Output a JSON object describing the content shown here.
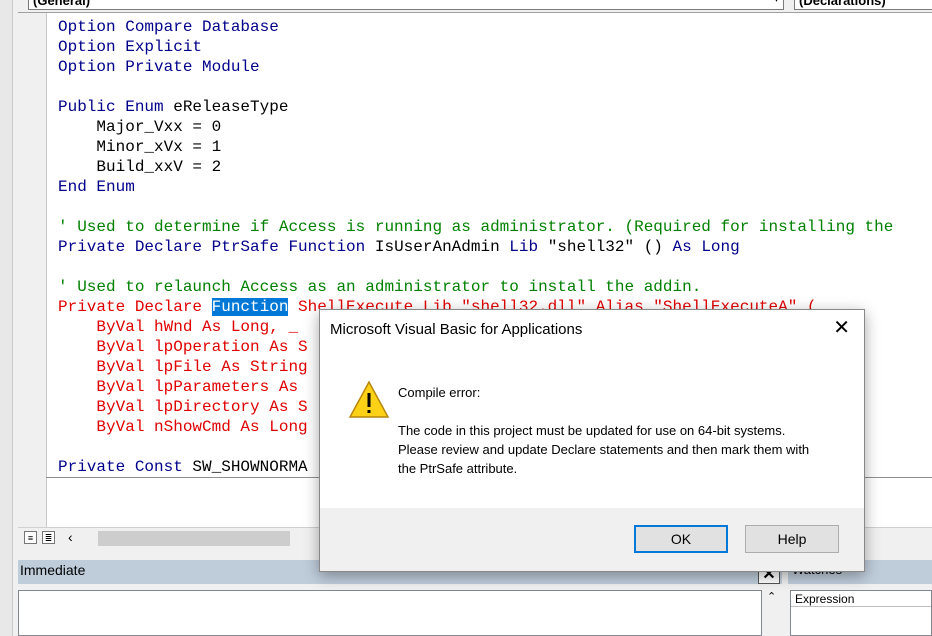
{
  "object_combo": "(General)",
  "proc_combo": "(Declarations)",
  "code_lines": [
    [
      {
        "t": "Option Compare Database",
        "c": "kw"
      }
    ],
    [
      {
        "t": "Option Explicit",
        "c": "kw"
      }
    ],
    [
      {
        "t": "Option Private Module",
        "c": "kw"
      }
    ],
    [],
    [
      {
        "t": "Public Enum ",
        "c": "kw"
      },
      {
        "t": "eReleaseType",
        "c": ""
      }
    ],
    [
      {
        "t": "    Major_Vxx = 0",
        "c": ""
      }
    ],
    [
      {
        "t": "    Minor_xVx = 1",
        "c": ""
      }
    ],
    [
      {
        "t": "    Build_xxV = 2",
        "c": ""
      }
    ],
    [
      {
        "t": "End Enum",
        "c": "kw"
      }
    ],
    [],
    [
      {
        "t": "' Used to determine if Access is running as administrator. (Required for installing the",
        "c": "cm"
      }
    ],
    [
      {
        "t": "Private Declare PtrSafe Function ",
        "c": "kw"
      },
      {
        "t": "IsUserAnAdmin ",
        "c": ""
      },
      {
        "t": "Lib ",
        "c": "kw"
      },
      {
        "t": "\"shell32\" () ",
        "c": ""
      },
      {
        "t": "As Long",
        "c": "kw"
      }
    ],
    [],
    [
      {
        "t": "' Used to relaunch Access as an administrator to install the addin.",
        "c": "cm"
      }
    ],
    [
      {
        "t": "Private Declare ",
        "c": "er"
      },
      {
        "t": "Function",
        "c": "sel"
      },
      {
        "t": " ShellExecute Lib \"shell32.dll\" Alias \"ShellExecuteA\" (_",
        "c": "er"
      }
    ],
    [
      {
        "t": "    ByVal hWnd As Long, _",
        "c": "er"
      }
    ],
    [
      {
        "t": "    ByVal lpOperation As S",
        "c": "er"
      }
    ],
    [
      {
        "t": "    ByVal lpFile As String",
        "c": "er"
      }
    ],
    [
      {
        "t": "    ByVal lpParameters As ",
        "c": "er"
      }
    ],
    [
      {
        "t": "    ByVal lpDirectory As S",
        "c": "er"
      }
    ],
    [
      {
        "t": "    ByVal nShowCmd As Long",
        "c": "er"
      }
    ],
    [],
    [
      {
        "t": "Private Const ",
        "c": "kw"
      },
      {
        "t": "SW_SHOWNORMA",
        "c": ""
      }
    ]
  ],
  "immediate_title": "Immediate",
  "watches_title": "Watches",
  "watches_column": "Expression",
  "dialog": {
    "title": "Microsoft Visual Basic for Applications",
    "heading": "Compile error:",
    "message": "The code in this project must be updated for use on 64-bit systems. Please review and update Declare statements and then mark them with the PtrSafe attribute.",
    "ok_label": "OK",
    "help_label": "Help",
    "close_glyph": "✕",
    "icon": "warning-icon"
  }
}
